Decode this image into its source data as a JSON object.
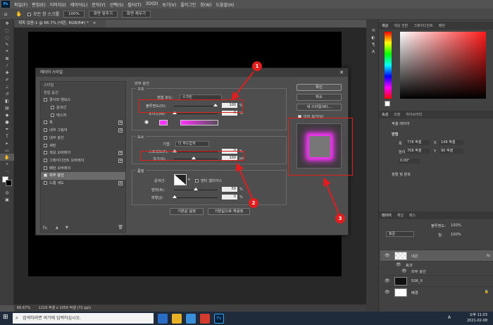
{
  "menu": {
    "items": [
      "파일(F)",
      "편집(E)",
      "이미지(I)",
      "레이어(L)",
      "문자(Y)",
      "선택(S)",
      "필터(T)",
      "3D(D)",
      "보기(V)",
      "플러그인",
      "창(W)",
      "도움말(H)"
    ]
  },
  "options": {
    "all_layers": "모든 창 스크롤",
    "zoom": "100%",
    "fit_screen": "화면 맞추기",
    "fill_screen": "화면 채우기"
  },
  "document": {
    "tab_title": "제목 없음-1 @ 66.7% (네온, RGB/8#) *",
    "zoom": "66.67%",
    "size": "1216 픽셀 x 1056 픽셀 (72 ppi)"
  },
  "panels": {
    "color_tabs": [
      "색상",
      "색상 견본",
      "그레이디언트",
      "패턴"
    ],
    "props_tabs": [
      "속성",
      "조정",
      "라이브러리"
    ],
    "pixel_layer": "픽셀 레이어",
    "transform": "변형",
    "w_label": "폭",
    "w_value": "778 픽셀",
    "x_label": "X",
    "x_value": "149 픽셀",
    "h_label": "높이",
    "h_value": "708 픽셀",
    "y_label": "Y",
    "y_value": "90 픽셀",
    "angle": "0.00°",
    "align": "정렬 및 분포",
    "layers_tabs": [
      "레이어",
      "채널",
      "패스"
    ],
    "blend": "표준",
    "opacity_label": "불투명도:",
    "opacity": "100%",
    "fill_label": "칠:",
    "fill": "100%",
    "layers": [
      {
        "name": "네온",
        "fx": "fx"
      },
      {
        "name": "효과"
      },
      {
        "name": "외부 광선"
      },
      {
        "name": "536_X"
      },
      {
        "name": "배경"
      }
    ]
  },
  "dialog": {
    "title": "레이어 스타일",
    "list": [
      {
        "label": "스타일",
        "header": true
      },
      {
        "label": "혼합 옵션",
        "header": true
      },
      {
        "label": "경사와 엠보스",
        "checked": false
      },
      {
        "label": "윤곽선",
        "checked": false,
        "indent": true
      },
      {
        "label": "텍스처",
        "checked": false,
        "indent": true
      },
      {
        "label": "획",
        "checked": false,
        "plus": true
      },
      {
        "label": "내부 그림자",
        "checked": false,
        "plus": true
      },
      {
        "label": "내부 광선",
        "checked": false
      },
      {
        "label": "새틴",
        "checked": false
      },
      {
        "label": "색상 오버레이",
        "checked": false,
        "plus": true
      },
      {
        "label": "그레이디언트 오버레이",
        "checked": false,
        "plus": true
      },
      {
        "label": "패턴 오버레이",
        "checked": false
      },
      {
        "label": "외부 광선",
        "checked": true,
        "selected": true
      },
      {
        "label": "드롭 섀도",
        "checked": false,
        "plus": true
      }
    ],
    "footer": {
      "fx": "fx.",
      "up": "▲",
      "down": "▼",
      "trash": "🗑"
    },
    "section_title": "외부 광선",
    "structure": "구조",
    "blend_mode_label": "혼합 모드:",
    "blend_mode": "스크린",
    "opacity_label": "불투명도(O):",
    "opacity_value": "100",
    "opacity_unit": "%",
    "noise_label": "노이즈(N):",
    "noise_value": "0",
    "noise_unit": "%",
    "elements": "요소",
    "technique_label": "기법:",
    "technique": "더 부드럽게",
    "spread_label": "스프레드(P):",
    "spread_value": "0",
    "spread_unit": "%",
    "size_label": "크기(S):",
    "size_value": "100",
    "size_unit": "px",
    "quality": "품질",
    "contour_label": "윤곽선:",
    "antialias": "앤티 앨리어스",
    "range_label": "범위(R):",
    "range_value": "50",
    "range_unit": "%",
    "jitter_label": "파형(J):",
    "jitter_value": "0",
    "jitter_unit": "%",
    "default_set": "기본값 설정",
    "default_reset": "기본값으로 재설정",
    "ok": "확인",
    "cancel": "취소",
    "new_style": "새 스타일(W)...",
    "preview": "미리 보기(V)",
    "glow_color": "#ff33ff"
  },
  "annotations": {
    "one": "1",
    "two": "2",
    "three": "3",
    "color": "#e21d1d"
  },
  "taskbar": {
    "search": "검색하려면 여기에 입력하십시오.",
    "time": "오후 11:03",
    "date": "2021-02-08",
    "lang": "A"
  }
}
